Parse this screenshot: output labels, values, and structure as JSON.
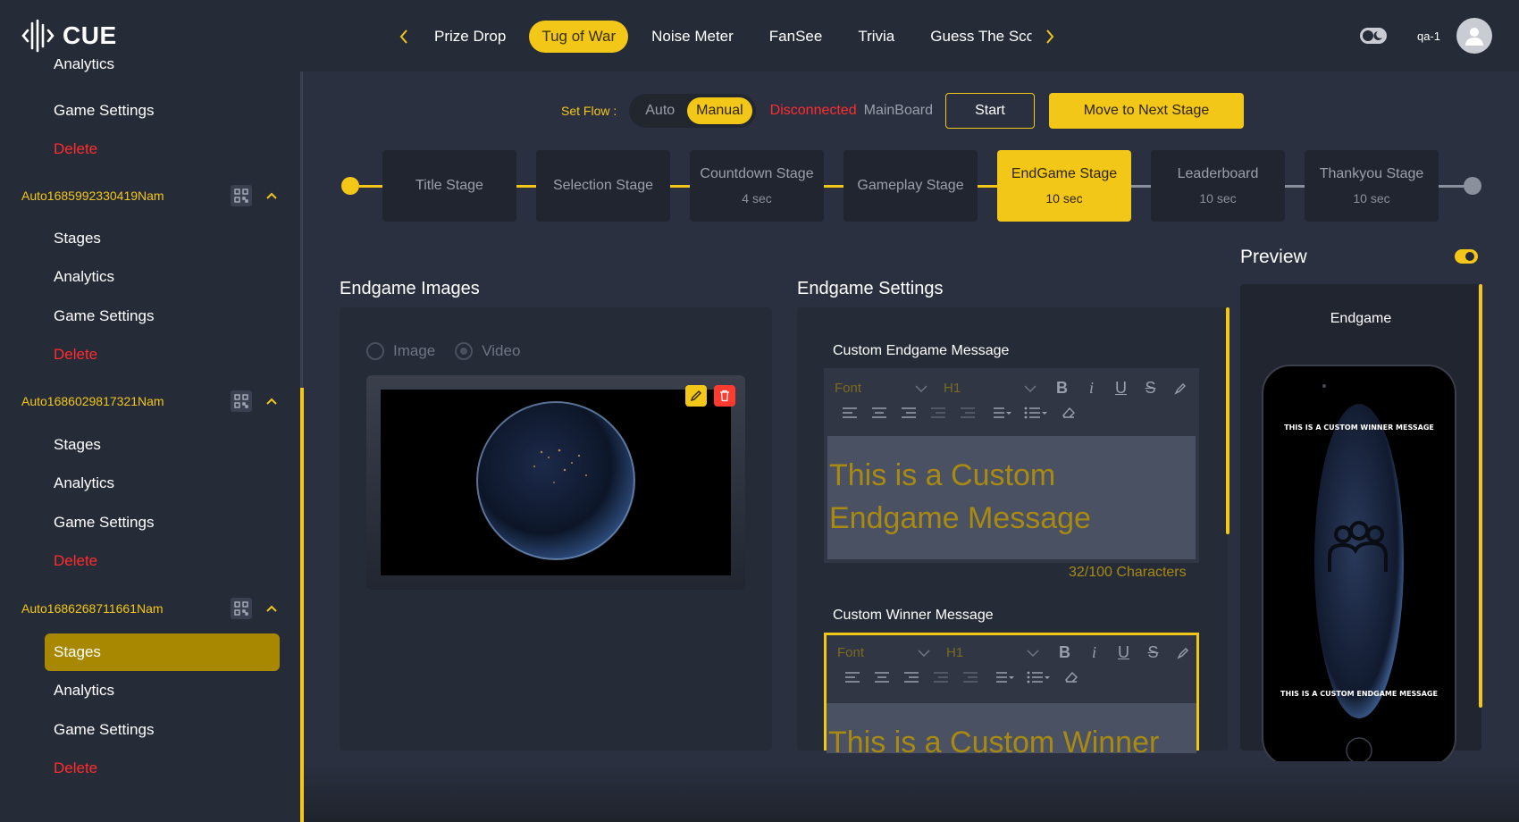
{
  "app": {
    "name": "CUE"
  },
  "tabs": [
    {
      "label": "Prize Drop",
      "active": false
    },
    {
      "label": "Tug of War",
      "active": true
    },
    {
      "label": "Noise Meter",
      "active": false
    },
    {
      "label": "FanSee",
      "active": false
    },
    {
      "label": "Trivia",
      "active": false
    },
    {
      "label": "Guess The Sco",
      "active": false
    }
  ],
  "user": {
    "name": "qa-1"
  },
  "sidebar": {
    "top_items": [
      {
        "label": "Analytics"
      },
      {
        "label": "Game Settings"
      },
      {
        "label": "Delete"
      }
    ],
    "groups": [
      {
        "name": "Auto1685992330419Nam",
        "items": [
          "Stages",
          "Analytics",
          "Game Settings",
          "Delete"
        ]
      },
      {
        "name": "Auto1686029817321Nam",
        "items": [
          "Stages",
          "Analytics",
          "Game Settings",
          "Delete"
        ]
      },
      {
        "name": "Auto1686268711661Nam",
        "items": [
          "Stages",
          "Analytics",
          "Game Settings",
          "Delete"
        ],
        "active_item": "Stages"
      }
    ]
  },
  "flow": {
    "label": "Set Flow :",
    "options": [
      "Auto",
      "Manual"
    ],
    "selected": "Manual",
    "status": "Disconnected",
    "board": "MainBoard",
    "start_label": "Start",
    "next_label": "Move to Next Stage"
  },
  "stages": [
    {
      "name": "Title Stage",
      "time": ""
    },
    {
      "name": "Selection Stage",
      "time": ""
    },
    {
      "name": "Countdown Stage",
      "time": "4 sec"
    },
    {
      "name": "Gameplay Stage",
      "time": ""
    },
    {
      "name": "EndGame Stage",
      "time": "10 sec",
      "active": true
    },
    {
      "name": "Leaderboard",
      "time": "10 sec"
    },
    {
      "name": "Thankyou Stage",
      "time": "10 sec"
    }
  ],
  "images_panel": {
    "title": "Endgame Images",
    "radio_options": [
      "Image",
      "Video"
    ],
    "selected": "Video"
  },
  "settings_panel": {
    "title": "Endgame Settings",
    "toolbar": {
      "font": "Font",
      "heading": "H1"
    },
    "endgame_message": {
      "label": "Custom Endgame Message",
      "text": "This is a Custom Endgame Message",
      "count": "32/100 Characters"
    },
    "winner_message": {
      "label": "Custom Winner Message",
      "text": "This is a Custom Winner"
    }
  },
  "preview": {
    "title": "Preview",
    "enabled": true,
    "screen_label": "Endgame",
    "winner_text": "THIS IS A CUSTOM WINNER MESSAGE",
    "endgame_text": "THIS IS A CUSTOM ENDGAME MESSAGE"
  },
  "colors": {
    "accent": "#f3c718",
    "danger": "#ff2d2d",
    "background": "#2a3040",
    "panel": "#262b38"
  }
}
